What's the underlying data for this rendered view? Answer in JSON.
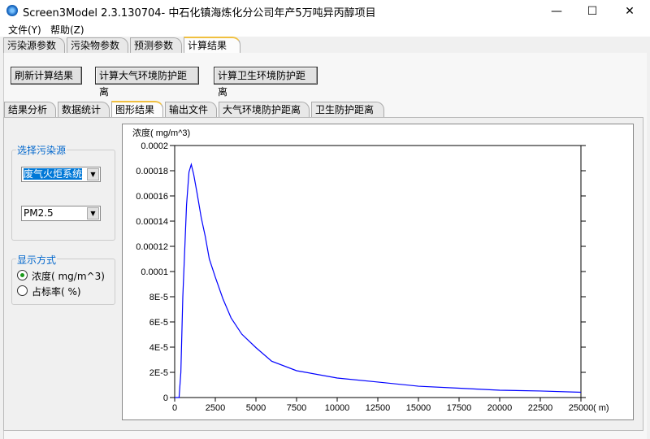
{
  "window": {
    "title": "Screen3Model 2.3.130704- 中石化镇海炼化分公司年产5万吨异丙醇项目",
    "minimize": "—",
    "maximize": "☐",
    "close": "✕"
  },
  "menu": [
    "文件(Y)",
    "帮助(Z)"
  ],
  "top_tabs": [
    "污染源参数",
    "污染物参数",
    "预测参数",
    "计算结果"
  ],
  "buttons": {
    "refresh": "刷新计算结果",
    "atmos": "计算大气环境防护距离",
    "hygiene": "计算卫生环境防护距离"
  },
  "sub_tabs": [
    "结果分析",
    "数据统计",
    "图形结果",
    "输出文件",
    "大气环境防护距离",
    "卫生防护距离"
  ],
  "source_group": {
    "label": "选择污染源",
    "source": "废气火炬系统",
    "pollutant": "PM2.5"
  },
  "display_group": {
    "label": "显示方式",
    "options": [
      "浓度( mg/m^3)",
      "占标率( %)"
    ],
    "selected": 0
  },
  "chart_data": {
    "type": "line",
    "ylabel": "浓度( mg/m^3)",
    "xlabel": "( m)",
    "xlim": [
      0,
      25000
    ],
    "ylim": [
      0,
      0.0002
    ],
    "xticks": [
      "0",
      "2500",
      "5000",
      "7500",
      "10000",
      "12500",
      "15000",
      "17500",
      "20000",
      "22500",
      "25000"
    ],
    "yticks": [
      "0",
      "2E-5",
      "4E-5",
      "6E-5",
      "8E-5",
      "0.0001",
      "0.00012",
      "0.00014",
      "0.00016",
      "0.00018",
      "0.0002"
    ],
    "series": [
      {
        "name": "PM2.5",
        "color": "#0000ff",
        "x": [
          0,
          270,
          380,
          500,
          630,
          730,
          880,
          1020,
          1170,
          1380,
          1630,
          1880,
          2130,
          2500,
          2970,
          3470,
          4130,
          5000,
          5970,
          7500,
          10000,
          12500,
          15000,
          17500,
          20000,
          22500,
          25000
        ],
        "y": [
          0,
          0,
          2e-05,
          8e-05,
          0.000121,
          0.000153,
          0.000179,
          0.000185,
          0.000177,
          0.000162,
          0.000143,
          0.000128,
          0.00011,
          9.55e-05,
          7.83e-05,
          6.32e-05,
          5.03e-05,
          3.96e-05,
          2.88e-05,
          2.13e-05,
          1.55e-05,
          1.23e-05,
          9e-06,
          7.4e-06,
          5.8e-06,
          5.2e-06,
          4.2e-06
        ]
      }
    ]
  }
}
